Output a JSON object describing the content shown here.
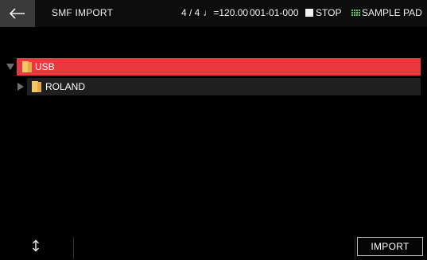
{
  "header": {
    "back_icon": "back-arrow-icon",
    "title": "SMF IMPORT",
    "time_signature": "4 / 4",
    "tempo_glyph": "♩",
    "tempo": "=120.00",
    "position": "001-01-000",
    "transport_state": "STOP",
    "pad_mode": "SAMPLE PAD",
    "pad_icon_color": "#4ed05a"
  },
  "tree": {
    "items": [
      {
        "label": "USB",
        "expanded": true,
        "selected": true,
        "icon": "folder-icon"
      },
      {
        "label": "ROLAND",
        "expanded": false,
        "selected": false,
        "icon": "folder-icon"
      }
    ],
    "selected_color": "#e8393e",
    "folder_color": "#f4c766"
  },
  "footer": {
    "scroll_icon": "up-down-arrow-icon",
    "import_label": "IMPORT"
  }
}
